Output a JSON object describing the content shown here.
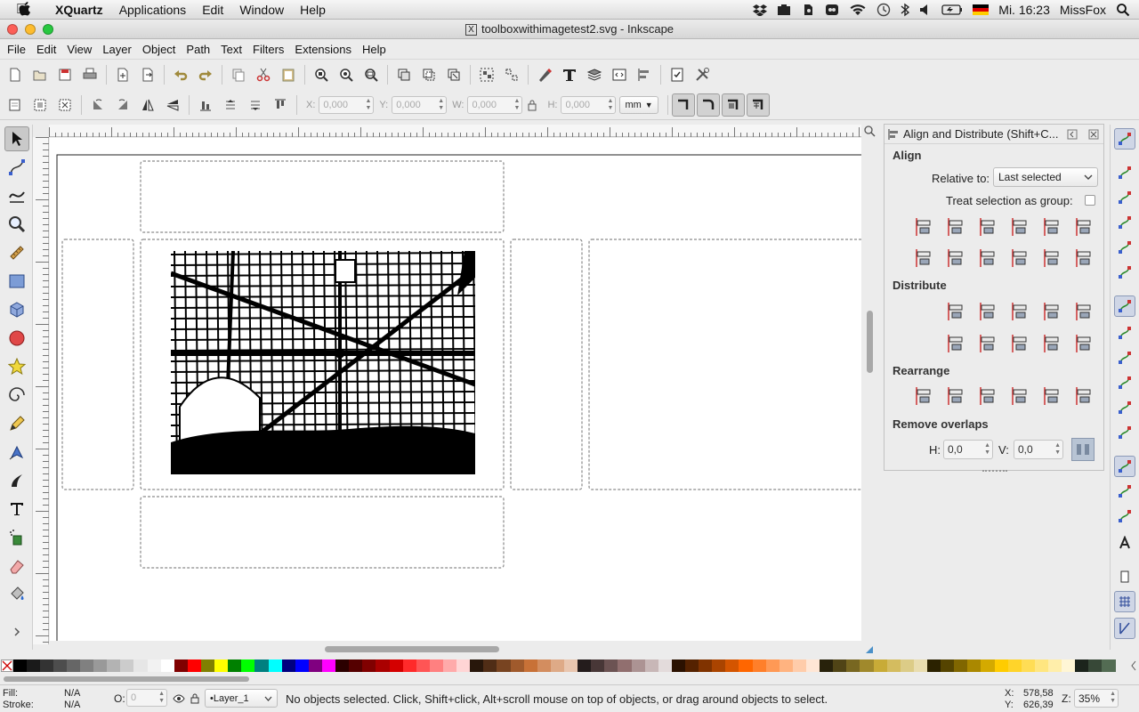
{
  "mac_menu": {
    "app": "XQuartz",
    "items": [
      "Applications",
      "Edit",
      "Window",
      "Help"
    ],
    "language_flag": "German",
    "clock": "Mi. 16:23",
    "user": "MissFox"
  },
  "window": {
    "title": "toolboxwithimagetest2.svg - Inkscape",
    "x_glyph": "X"
  },
  "app_menu": [
    "File",
    "Edit",
    "View",
    "Layer",
    "Object",
    "Path",
    "Text",
    "Filters",
    "Extensions",
    "Help"
  ],
  "select_toolbar": {
    "x_label": "X:",
    "x_value": "0,000",
    "y_label": "Y:",
    "y_value": "0,000",
    "w_label": "W:",
    "w_value": "0,000",
    "h_label": "H:",
    "h_value": "0,000",
    "unit": "mm"
  },
  "toolbox_icons": [
    "selector-icon",
    "node-icon",
    "tweak-icon",
    "zoom-icon",
    "measure-icon",
    "rectangle-icon",
    "3d-box-icon",
    "ellipse-icon",
    "star-icon",
    "spiral-icon",
    "pencil-icon",
    "pen-icon",
    "calligraphy-icon",
    "text-icon",
    "spray-icon",
    "eraser-icon",
    "paint-bucket-icon"
  ],
  "dock": {
    "title": "Align and Distribute (Shift+C...",
    "align_heading": "Align",
    "relative_to_label": "Relative to:",
    "relative_to_value": "Last selected",
    "treat_group_label": "Treat selection as group:",
    "treat_group_checked": false,
    "distribute_heading": "Distribute",
    "rearrange_heading": "Rearrange",
    "remove_overlaps_heading": "Remove overlaps",
    "h_label": "H:",
    "h_value": "0,0",
    "v_label": "V:",
    "v_value": "0,0"
  },
  "status": {
    "fill_label": "Fill:",
    "fill_value": "N/A",
    "stroke_label": "Stroke:",
    "stroke_value": "N/A",
    "opacity_label": "O:",
    "opacity_value": "0",
    "layer": "•Layer_1",
    "message": "No objects selected. Click, Shift+click, Alt+scroll mouse on top of objects, or drag around objects to select.",
    "x_label": "X:",
    "x_value": "578,58",
    "y_label": "Y:",
    "y_value": "626,39",
    "zoom_label": "Z:",
    "zoom_value": "35%"
  },
  "palette_colors": [
    "#000000",
    "#1a1a1a",
    "#333333",
    "#4d4d4d",
    "#666666",
    "#808080",
    "#999999",
    "#b3b3b3",
    "#cccccc",
    "#e6e6e6",
    "#f2f2f2",
    "#ffffff",
    "#800000",
    "#ff0000",
    "#808000",
    "#ffff00",
    "#008000",
    "#00ff00",
    "#008080",
    "#00ffff",
    "#000080",
    "#0000ff",
    "#800080",
    "#ff00ff",
    "#2b0000",
    "#550000",
    "#800000",
    "#aa0000",
    "#d40000",
    "#ff2a2a",
    "#ff5555",
    "#ff8080",
    "#ffaaaa",
    "#ffd5d5",
    "#28170b",
    "#502d16",
    "#784421",
    "#a05a2c",
    "#c87137",
    "#d38d5f",
    "#deaa87",
    "#e9c6af",
    "#241c1c",
    "#483737",
    "#6c5353",
    "#916f6f",
    "#ac9393",
    "#c8b7b7",
    "#e3dbdb",
    "#2b1100",
    "#552200",
    "#803300",
    "#aa4400",
    "#d45500",
    "#ff6600",
    "#ff7f2a",
    "#ff9955",
    "#ffb380",
    "#ffccaa",
    "#ffe6d5",
    "#28220b",
    "#504416",
    "#786721",
    "#a0892c",
    "#c8ab37",
    "#d4bc5f",
    "#dccc87",
    "#e9ddaf",
    "#2b2200",
    "#554400",
    "#806600",
    "#aa8800",
    "#d4aa00",
    "#ffcc00",
    "#ffd42a",
    "#ffdd55",
    "#ffe680",
    "#ffeeaa",
    "#fff6d5",
    "#1c241c",
    "#374837",
    "#536c53"
  ]
}
